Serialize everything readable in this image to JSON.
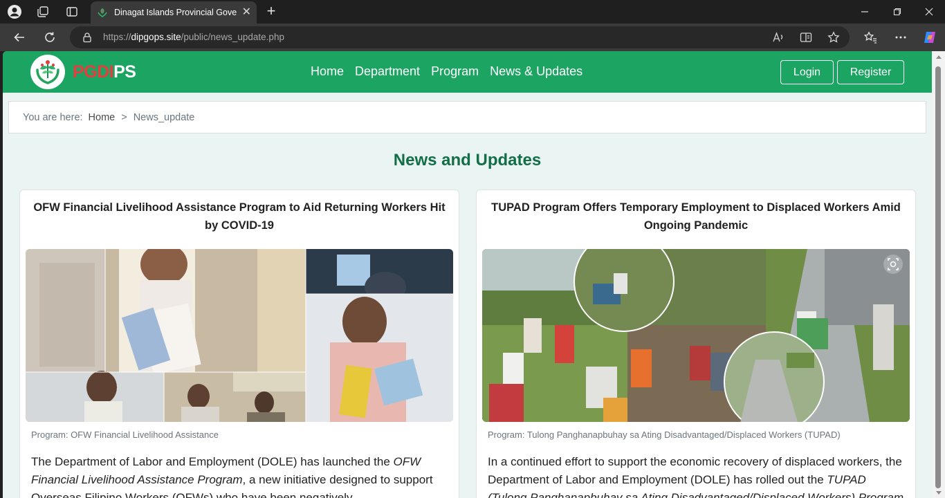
{
  "browser": {
    "tab_title": "Dinagat Islands Provincial Government",
    "url_prefix": "https://",
    "url_host": "dipgops.site",
    "url_path": "/public/news_update.php"
  },
  "site": {
    "brand_part1": "PGDI",
    "brand_part2": "PS",
    "nav": [
      "Home",
      "Department",
      "Program",
      "News & Updates"
    ],
    "login_label": "Login",
    "register_label": "Register",
    "brand_green": "#1ba462",
    "accent_red": "#e53e3e"
  },
  "breadcrumb": {
    "prefix": "You are here:",
    "home": "Home",
    "separator": ">",
    "current": "News_update"
  },
  "page_title": "News and Updates",
  "cards": [
    {
      "title": "OFW Financial Livelihood Assistance Program to Aid Returning Workers Hit by COVID-19",
      "program": "Program: OFW Financial Livelihood Assistance",
      "body_1": "The Department of Labor and Employment (DOLE) has launched the ",
      "body_em": "OFW Financial Livelihood Assistance Program",
      "body_2": ", a new initiative designed to support Overseas Filipino Workers (OFWs) who have been negatively"
    },
    {
      "title": "TUPAD Program Offers Temporary Employment to Displaced Workers Amid Ongoing Pandemic",
      "program": "Program: Tulong Panghanapbuhay sa Ating Disadvantaged/Displaced Workers (TUPAD)",
      "body_1": "In a continued effort to support the economic recovery of displaced workers, the Department of Labor and Employment (DOLE) has rolled out the ",
      "body_em": "TUPAD (Tulong Panghanapbuhay sa Ating Disadvantaged/Displaced Workers) Program",
      "body_2": ""
    }
  ]
}
